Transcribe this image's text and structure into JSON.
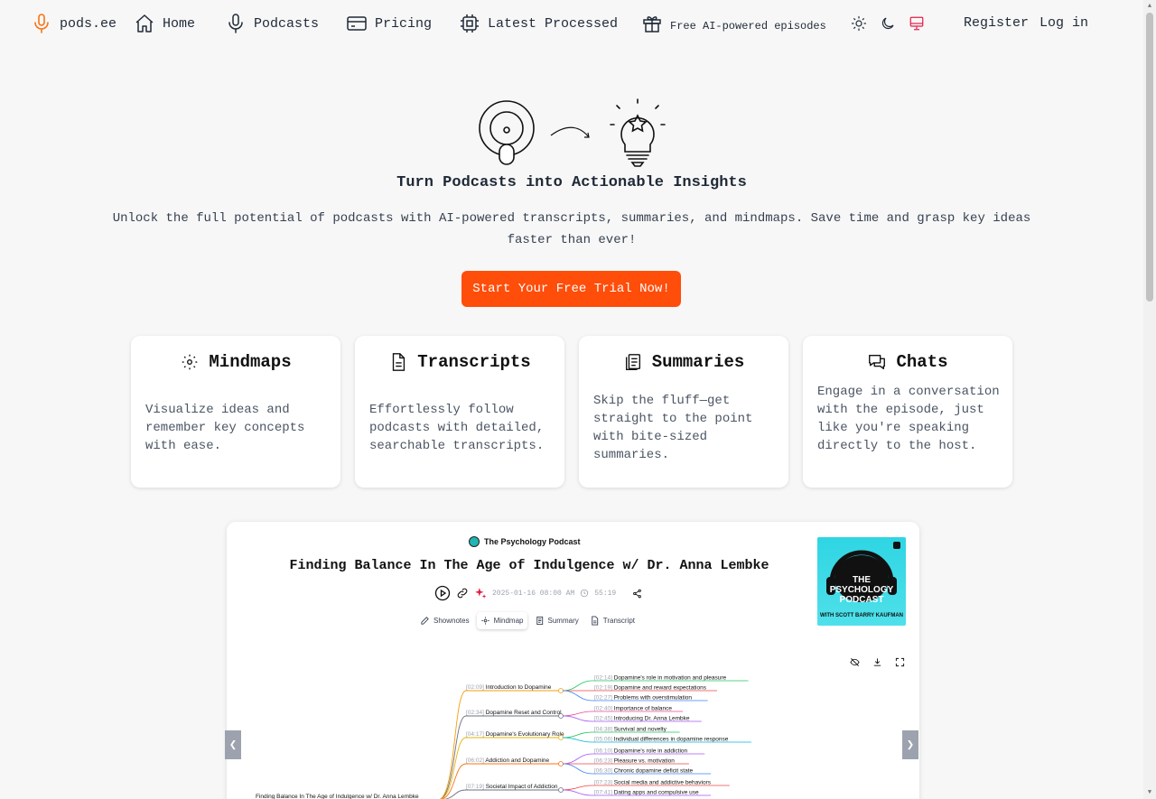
{
  "nav": {
    "brand": "pods.ee",
    "home": "Home",
    "podcasts": "Podcasts",
    "pricing": "Pricing",
    "latest": "Latest Processed",
    "free": "Free AI-powered episodes",
    "register": "Register",
    "login": "Log in"
  },
  "hero": {
    "title": "Turn Podcasts into Actionable Insights",
    "subtitle": "Unlock the full potential of podcasts with AI-powered transcripts, summaries, and mindmaps. Save time and grasp key ideas faster than ever!",
    "cta": "Start Your Free Trial Now!"
  },
  "features": [
    {
      "title": "Mindmaps",
      "text": "Visualize ideas and remember key concepts with ease."
    },
    {
      "title": "Transcripts",
      "text": "Effortlessly follow podcasts with detailed, searchable transcripts."
    },
    {
      "title": "Summaries",
      "text": "Skip the fluff—get straight to the point with bite-sized summaries."
    },
    {
      "title": "Chats",
      "text": "Engage in a conversation with the episode, just like you're speaking directly to the host."
    }
  ],
  "preview": {
    "podcast_name": "The Psychology Podcast",
    "episode_title": "Finding Balance In The Age of Indulgence w/ Dr. Anna Lembke",
    "date": "2025-01-16 08:00 AM",
    "duration": "55:19",
    "tabs": [
      "Shownotes",
      "Mindmap",
      "Summary",
      "Transcript"
    ],
    "cover_title_1": "THE",
    "cover_title_2": "PSYCHOLOGY",
    "cover_title_3": "PODCAST",
    "cover_subtitle": "WITH SCOTT BARRY KAUFMAN",
    "mindmap": {
      "root": "Finding Balance In The Age of Indulgence w/ Dr. Anna Lembke",
      "branches": [
        {
          "ts": "[02:09]",
          "label": "Introduction to Dopamine",
          "color": "#f59e0b",
          "children": [
            {
              "ts": "[02:14]",
              "label": "Dopamine's role in motivation and pleasure",
              "color": "#22c55e"
            },
            {
              "ts": "[02:19]",
              "label": "Dopamine and reward expectations",
              "color": "#ef4444"
            },
            {
              "ts": "[02:27]",
              "label": "Problems with overstimulation",
              "color": "#3b82f6"
            }
          ]
        },
        {
          "ts": "[02:34]",
          "label": "Dopamine Reset and Control",
          "color": "#6b7280",
          "children": [
            {
              "ts": "[02:40]",
              "label": "Importance of balance",
              "color": "#ec4899"
            },
            {
              "ts": "[02:45]",
              "label": "Introducing Dr. Anna Lembke",
              "color": "#a855f7"
            }
          ]
        },
        {
          "ts": "[04:17]",
          "label": "Dopamine's Evolutionary Role",
          "color": "#eab308",
          "children": [
            {
              "ts": "[04:38]",
              "label": "Survival and novelty",
              "color": "#22c55e"
            },
            {
              "ts": "[05:06]",
              "label": "Individual differences in dopamine response",
              "color": "#06b6d4"
            }
          ]
        },
        {
          "ts": "[06:02]",
          "label": "Addiction and Dopamine",
          "color": "#f97316",
          "children": [
            {
              "ts": "[06:10]",
              "label": "Dopamine's role in addiction",
              "color": "#a855f7"
            },
            {
              "ts": "[06:23]",
              "label": "Pleasure vs. motivation",
              "color": "#ef4444"
            },
            {
              "ts": "[06:30]",
              "label": "Chronic dopamine deficit state",
              "color": "#3b82f6"
            }
          ]
        },
        {
          "ts": "[07:19]",
          "label": "Societal Impact of Addiction",
          "color": "#6b7280",
          "children": [
            {
              "ts": "[07:23]",
              "label": "Social media and addictive behaviors",
              "color": "#ef4444"
            },
            {
              "ts": "[07:41]",
              "label": "Dating apps and compulsive use",
              "color": "#a855f7"
            }
          ]
        }
      ]
    }
  },
  "carousel": {
    "prev": "❮",
    "next": "❯"
  },
  "colors": {
    "accent": "#ff4d0a",
    "brand_icon": "#f97316",
    "system_theme": "#e11d48"
  }
}
